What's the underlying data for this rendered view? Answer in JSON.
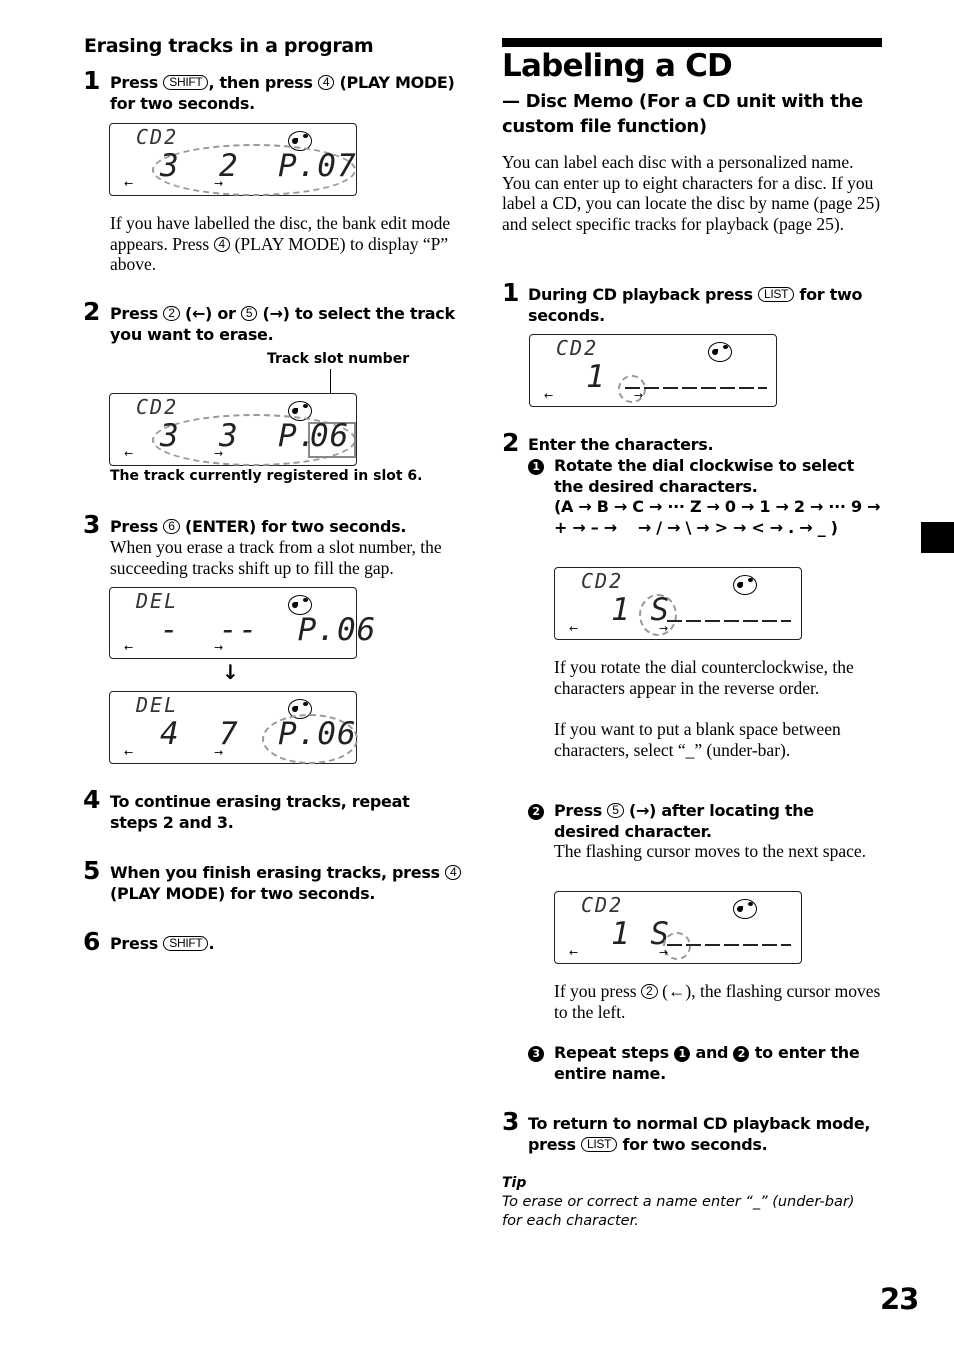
{
  "page_number": "23",
  "left": {
    "section_title": "Erasing tracks in a program",
    "steps": [
      {
        "num": "1",
        "pre": "Press ",
        "key1": "SHIFT",
        "mid": ", then press ",
        "key2": "4",
        "post": " (PLAY MODE) for two seconds."
      },
      {
        "num": "2",
        "pre": "Press ",
        "key1": "2",
        "mid": " (←) or ",
        "key2": "5",
        "post": " (→) to select the track you want to erase."
      },
      {
        "num": "3",
        "pre": "Press ",
        "key1": "6",
        "post": " (ENTER) for two seconds."
      },
      {
        "num": "4",
        "text": "To continue erasing tracks, repeat steps 2 and 3."
      },
      {
        "num": "5",
        "pre": "When you finish erasing tracks, press ",
        "key1": "4",
        "post": " (PLAY MODE) for two seconds."
      },
      {
        "num": "6",
        "pre": "Press ",
        "key1": "SHIFT",
        "post": "."
      }
    ],
    "note1_pre": "If you have labelled the disc, the bank edit mode appears. Press ",
    "note1_key": "4",
    "note1_post": " (PLAY MODE) to display “P” above.",
    "callout_track_slot": "Track slot number",
    "caption_slot": "The track currently registered in slot 6.",
    "note3": "When you erase a track from a slot number, the succeeding tracks shift up to fill the gap.",
    "displays": {
      "d1": {
        "top": "CD2",
        "main": "3  2  P.07"
      },
      "d2": {
        "top": "CD2",
        "main": "3  3  P.",
        "slot": "06"
      },
      "d3": {
        "top": "DEL",
        "main": "-  --  P.06"
      },
      "d4": {
        "top": "DEL",
        "main": "4  7  P.06"
      },
      "down_arrow": "↓"
    }
  },
  "right": {
    "title": "Labeling a CD",
    "subtitle": "— Disc Memo (For a CD unit with the custom file function)",
    "intro": "You can label each disc with a personalized name. You can enter up to eight characters for a disc. If you label a CD, you can locate the disc by name (page 25) and select specific tracks for playback (page 25).",
    "step1": {
      "num": "1",
      "pre": "During CD playback press ",
      "key": "LIST",
      "post": " for two seconds."
    },
    "step2": {
      "num": "2",
      "text": "Enter the characters."
    },
    "sub1": {
      "marker": "1",
      "text": "Rotate the dial clockwise to select the desired characters.",
      "sequence": "(A → B → C → ··· Z → 0 → 1 → 2 → ··· 9 → + → – →    → / → \\ → > → < → . → _ )"
    },
    "note_ccw": "If you rotate the dial counterclockwise, the characters appear in the reverse order.",
    "note_blank": "If you want to put a blank space between characters, select “_” (under-bar).",
    "sub2": {
      "marker": "2",
      "pre": "Press ",
      "key": "5",
      "post": " (→) after locating the desired character."
    },
    "note_cursor": "The flashing cursor moves to the next space.",
    "note_left_pre": "If you press ",
    "note_left_key": "2",
    "note_left_post": " (←), the flashing cursor moves to the left.",
    "sub3": {
      "marker": "3",
      "pre": "Repeat steps ",
      "m1": "1",
      "mid": " and ",
      "m2": "2",
      "post": " to enter the entire name."
    },
    "step3": {
      "num": "3",
      "pre": "To return to normal CD playback mode, press ",
      "key": "LIST",
      "post": " for two seconds."
    },
    "tip_label": "Tip",
    "tip_text": "To erase or correct a name enter “_” (under-bar) for each character.",
    "displays": {
      "r1": {
        "top": "CD2",
        "main": "1"
      },
      "r2": {
        "top": "CD2",
        "main": "1 S"
      },
      "r3": {
        "top": "CD2",
        "main": "1 S"
      }
    }
  }
}
